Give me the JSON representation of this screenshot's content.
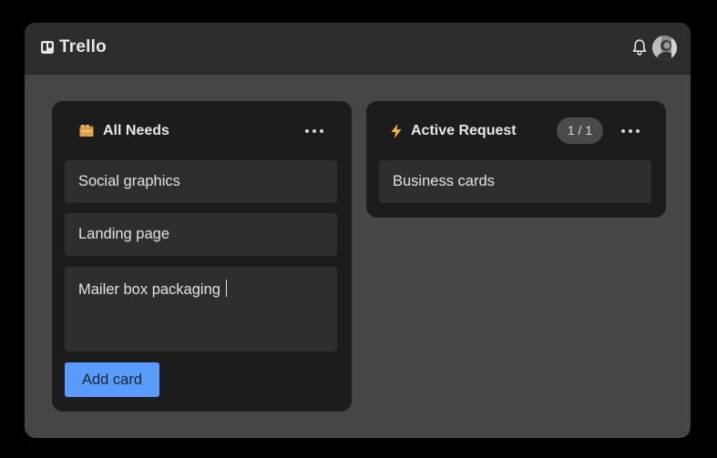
{
  "app": {
    "name": "Trello"
  },
  "topbar": {
    "logo_icon": "trello-board-icon",
    "notifications_icon": "bell-icon",
    "avatar_icon": "user-avatar"
  },
  "lists": [
    {
      "emoji_icon": "card-index-dividers-emoji",
      "title": "All Needs",
      "menu_icon": "more-horizontal-icon",
      "cards": [
        {
          "title": "Social graphics"
        },
        {
          "title": "Landing page"
        }
      ],
      "draft_card": {
        "text": "Mailer box packaging"
      },
      "add_card_label": "Add card"
    },
    {
      "emoji_icon": "lightning-emoji",
      "title": "Active Request",
      "wip_counter": "1 / 1",
      "menu_icon": "more-horizontal-icon",
      "cards": [
        {
          "title": "Business cards"
        }
      ]
    }
  ],
  "colors": {
    "background": "#000000",
    "board": "#464646",
    "topbar": "#2d2d2d",
    "list": "#1c1c1c",
    "card": "#2e2e2e",
    "accent": "#5a9bff"
  }
}
